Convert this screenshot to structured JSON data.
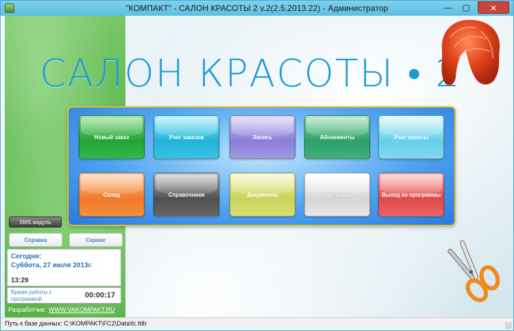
{
  "window": {
    "title": "\"КОМПАКТ\" - САЛОН КРАСОТЫ 2  v.2(2.5.2013.22)  -  Администратор",
    "minimize_glyph": "—",
    "maximize_glyph": "▢",
    "close_glyph": "✕"
  },
  "header": {
    "logo_text": "САЛОН КРАСОТЫ • 2"
  },
  "menu": {
    "tiles": [
      {
        "label": "Новый заказ"
      },
      {
        "label": "Учет заказов"
      },
      {
        "label": "Запись"
      },
      {
        "label": "Абонементы"
      },
      {
        "label": "Учет оплаты"
      },
      {
        "label": "Склад"
      },
      {
        "label": "Справочники"
      },
      {
        "label": "Документы"
      },
      {
        "label": "Настройки"
      },
      {
        "label": "Выход из программы"
      }
    ]
  },
  "sidebar": {
    "sms_button": "SMS модуль",
    "help_button": "Справка",
    "service_button": "Сервис",
    "today_label": "Сегодня:",
    "date": "Суббота, 27 июля 2013г.",
    "time": "13:29",
    "uptime_label": "Время работы с программой",
    "uptime": "00:00:17",
    "developer_label": "Разработчик:",
    "developer_link": "WWW.VAKOMPAKT.RU"
  },
  "statusbar": {
    "text": "Путь к базе данных: C:\\KOMPAKT\\FC2\\Data\\fc.fdb"
  },
  "colors": {
    "title_bar": "#6ec9ea",
    "logo": "#1c9bd1",
    "panel_border": "#e2c02c",
    "sidebar_green": "#5cb64b"
  }
}
